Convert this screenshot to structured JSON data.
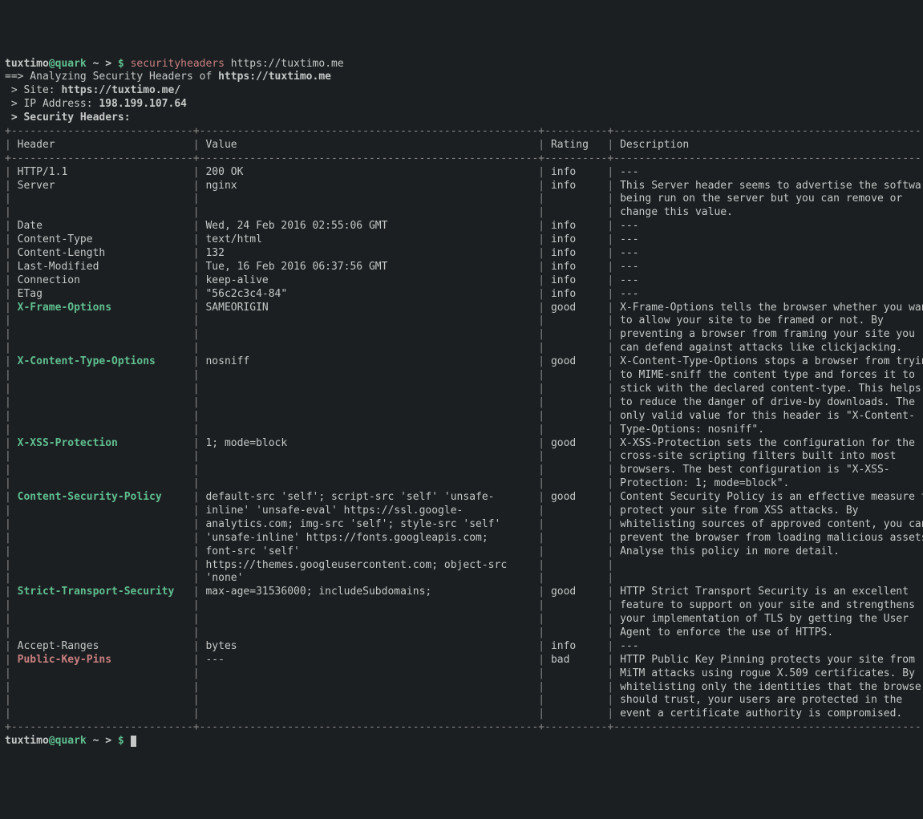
{
  "prompt": {
    "user": "tuxtimo",
    "at": "@",
    "host": "quark",
    "path": " ~ > ",
    "dollar": "$ "
  },
  "command": {
    "name": "securityheaders",
    "arg": "https://tuxtimo.me"
  },
  "analyzing_prefix": "==> Analyzing Security Headers of ",
  "analyzing_url": "https://tuxtimo.me",
  "site_label": " > Site: ",
  "site_value": "https://tuxtimo.me/",
  "ip_label": " > IP Address: ",
  "ip_value": "198.199.107.64",
  "sec_label": " > Security Headers:",
  "columns": {
    "header": "Header",
    "value": "Value",
    "rating": "Rating",
    "description": "Description"
  },
  "rows": [
    {
      "header": "HTTP/1.1",
      "header_style": "plain",
      "value": [
        "200 OK"
      ],
      "rating": "info",
      "description": [
        "---"
      ]
    },
    {
      "header": "Server",
      "header_style": "plain",
      "value": [
        "nginx"
      ],
      "rating": "info",
      "description": [
        "This Server header seems to advertise the software",
        "being run on the server but you can remove or",
        "change this value."
      ]
    },
    {
      "header": "Date",
      "header_style": "plain",
      "value": [
        "Wed, 24 Feb 2016 02:55:06 GMT"
      ],
      "rating": "info",
      "description": [
        "---"
      ]
    },
    {
      "header": "Content-Type",
      "header_style": "plain",
      "value": [
        "text/html"
      ],
      "rating": "info",
      "description": [
        "---"
      ]
    },
    {
      "header": "Content-Length",
      "header_style": "plain",
      "value": [
        "132"
      ],
      "rating": "info",
      "description": [
        "---"
      ]
    },
    {
      "header": "Last-Modified",
      "header_style": "plain",
      "value": [
        "Tue, 16 Feb 2016 06:37:56 GMT"
      ],
      "rating": "info",
      "description": [
        "---"
      ]
    },
    {
      "header": "Connection",
      "header_style": "plain",
      "value": [
        "keep-alive"
      ],
      "rating": "info",
      "description": [
        "---"
      ]
    },
    {
      "header": "ETag",
      "header_style": "plain",
      "value": [
        "\"56c2c3c4-84\""
      ],
      "rating": "info",
      "description": [
        "---"
      ]
    },
    {
      "header": "X-Frame-Options",
      "header_style": "good",
      "value": [
        "SAMEORIGIN"
      ],
      "rating": "good",
      "description": [
        "X-Frame-Options tells the browser whether you want",
        "to allow your site to be framed or not. By",
        "preventing a browser from framing your site you",
        "can defend against attacks like clickjacking."
      ]
    },
    {
      "header": "X-Content-Type-Options",
      "header_style": "good",
      "value": [
        "nosniff"
      ],
      "rating": "good",
      "description": [
        "X-Content-Type-Options stops a browser from trying",
        "to MIME-sniff the content type and forces it to",
        "stick with the declared content-type. This helps",
        "to reduce the danger of drive-by downloads. The",
        "only valid value for this header is \"X-Content-",
        "Type-Options: nosniff\"."
      ]
    },
    {
      "header": "X-XSS-Protection",
      "header_style": "good",
      "value": [
        "1; mode=block"
      ],
      "rating": "good",
      "description": [
        "X-XSS-Protection sets the configuration for the",
        "cross-site scripting filters built into most",
        "browsers. The best configuration is \"X-XSS-",
        "Protection: 1; mode=block\"."
      ]
    },
    {
      "header": "Content-Security-Policy",
      "header_style": "good",
      "value": [
        "default-src 'self'; script-src 'self' 'unsafe-",
        "inline' 'unsafe-eval' https://ssl.google-",
        "analytics.com; img-src 'self'; style-src 'self'",
        "'unsafe-inline' https://fonts.googleapis.com;",
        "font-src 'self'",
        "https://themes.googleusercontent.com; object-src",
        "'none'"
      ],
      "rating": "good",
      "description": [
        "Content Security Policy is an effective measure to",
        "protect your site from XSS attacks. By",
        "whitelisting sources of approved content, you can",
        "prevent the browser from loading malicious assets.",
        "Analyse this policy in more detail."
      ]
    },
    {
      "header": "Strict-Transport-Security",
      "header_style": "good",
      "value": [
        "max-age=31536000; includeSubdomains;"
      ],
      "rating": "good",
      "description": [
        "HTTP Strict Transport Security is an excellent",
        "feature to support on your site and strengthens",
        "your implementation of TLS by getting the User",
        "Agent to enforce the use of HTTPS."
      ]
    },
    {
      "header": "Accept-Ranges",
      "header_style": "plain",
      "value": [
        "bytes"
      ],
      "rating": "info",
      "description": [
        "---"
      ]
    },
    {
      "header": "Public-Key-Pins",
      "header_style": "bad",
      "value": [
        "---"
      ],
      "rating": "bad",
      "description": [
        "HTTP Public Key Pinning protects your site from",
        "MiTM attacks using rogue X.509 certificates. By",
        "whitelisting only the identities that the browser",
        "should trust, your users are protected in the",
        "event a certificate authority is compromised."
      ]
    }
  ],
  "widths": {
    "header": 27,
    "value": 52,
    "rating": 8,
    "description": 52
  }
}
